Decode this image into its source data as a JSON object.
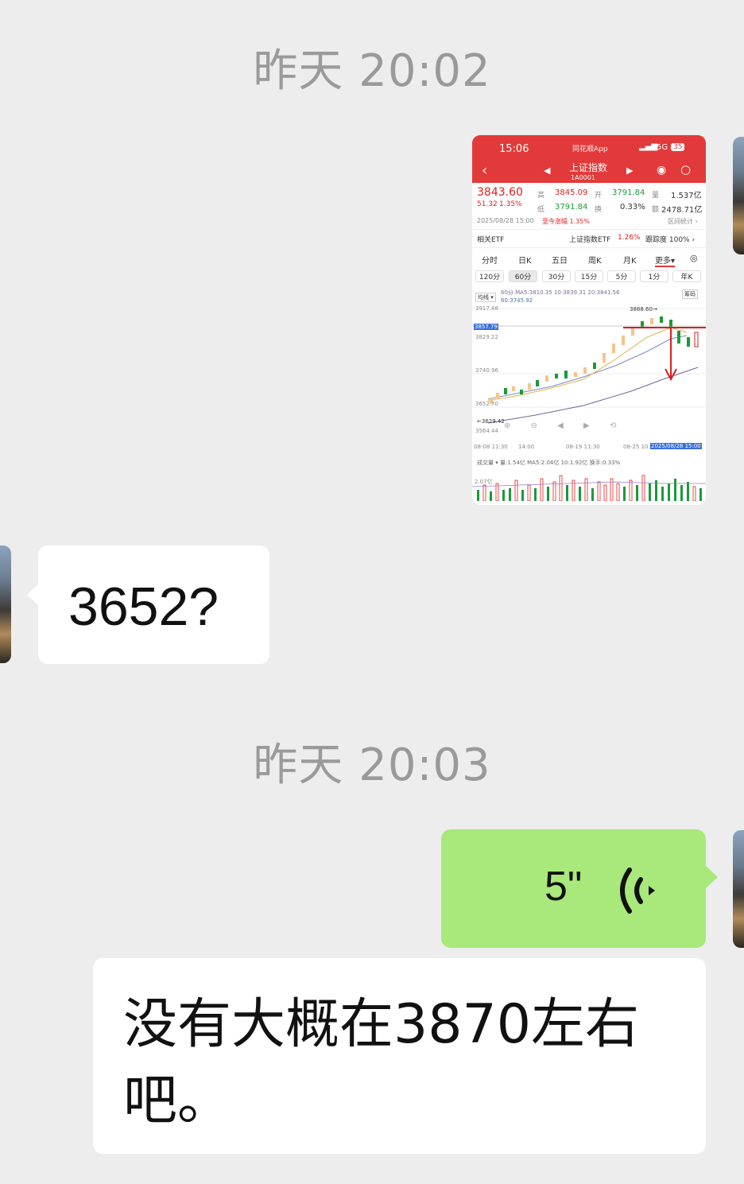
{
  "timestamps": [
    "昨天 20:02",
    "昨天 20:03"
  ],
  "screenshot": {
    "status_time": "15:06",
    "app_name": "同花顺App",
    "network": "5G",
    "battery": "35",
    "title": "上证指数",
    "code": "1A0001",
    "price": "3843.60",
    "change": "51.32",
    "change_pct": "1.35%",
    "high_label": "高",
    "high": "3845.09",
    "open_label": "开",
    "open": "3791.84",
    "vol_label": "量",
    "vol": "1.537亿",
    "low_label": "低",
    "low": "3791.84",
    "turn_label": "换",
    "turn": "0.33%",
    "amt_label": "额",
    "amt": "2478.71亿",
    "date": "2025/08/28 15:00",
    "since": "至今涨幅 1.35%",
    "range_stat": "区间统计 ›",
    "etf_label": "相关ETF",
    "etf_name": "上证指数ETF",
    "etf_pct": "1.26%",
    "etf_track": "跟踪度 100% ›",
    "period_tabs": [
      "分时",
      "日K",
      "五日",
      "周K",
      "月K",
      "更多▾"
    ],
    "sub_tabs": [
      "120分",
      "60分",
      "30分",
      "15分",
      "5分",
      "1分",
      "年K"
    ],
    "ma_line1": "60分  MA5:3810.35  10:3839.31  20:3841.56",
    "ma_line2": "60:3745.92",
    "ma_btn": "均线 ▾",
    "chip_btn": "筹码",
    "y_labels": [
      "3917.48",
      "3857.79",
      "3829.22",
      "3740.96",
      "3652.70",
      "3564.44"
    ],
    "peak_label": "3888.60→",
    "low_point": "←3629.42",
    "x_labels": [
      "08-08 11:30",
      "14:00",
      "08-19 11:30",
      "08-25 10",
      "2025/08/28 15:00"
    ],
    "vol_line": "成交量 ▾  量:1.54亿  MA5:2.04亿  10:1.92亿  换手:0.33%",
    "vol_y": "2.07亿"
  },
  "messages": {
    "question": "3652?",
    "voice_duration": "5\"",
    "answer": "没有大概在3870左右吧。"
  },
  "colors": {
    "background": "#ededed",
    "green_bubble": "#a9e87b",
    "header_red": "#e23a3a"
  }
}
